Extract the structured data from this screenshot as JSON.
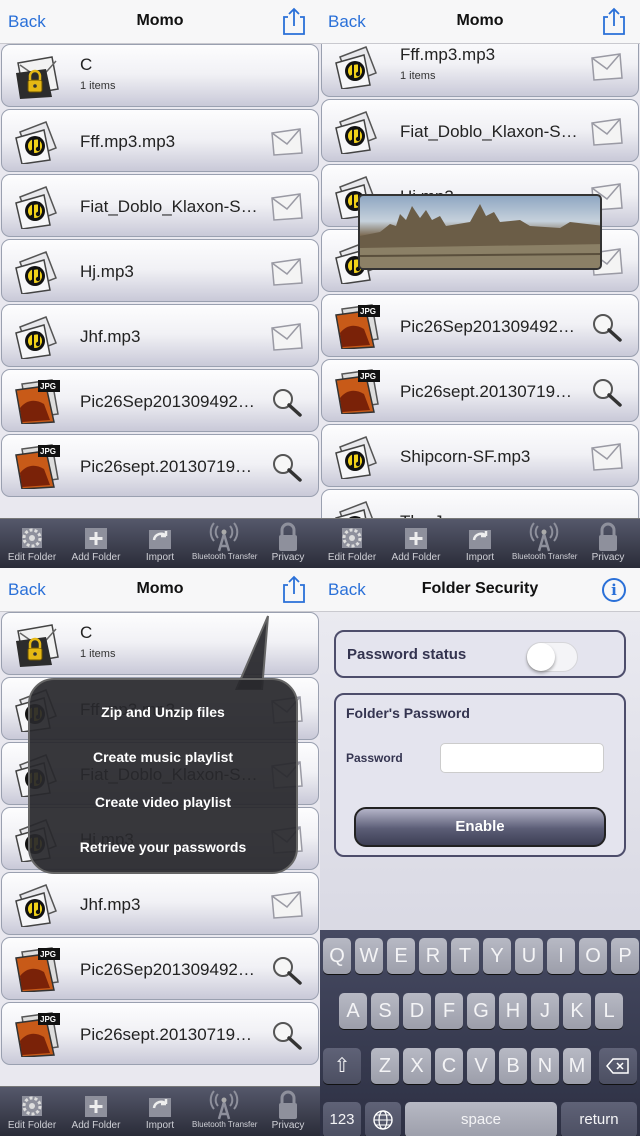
{
  "nav": {
    "back_label": "Back",
    "title": "Momo"
  },
  "security_nav": {
    "back_label": "Back",
    "title": "Folder Security"
  },
  "quadrant1": {
    "rows": [
      {
        "name": "C",
        "sub": "1 items",
        "icon": "folder-lock-icon",
        "action": ""
      },
      {
        "name": "Fff.mp3.mp3",
        "icon": "music-file-icon",
        "action": "mail-icon"
      },
      {
        "name": "Fiat_Doblo_Klaxon-S…",
        "icon": "music-file-icon",
        "action": "mail-icon"
      },
      {
        "name": "Hj.mp3",
        "icon": "music-file-icon",
        "action": "mail-icon"
      },
      {
        "name": "Jhf.mp3",
        "icon": "music-file-icon",
        "action": "mail-icon"
      },
      {
        "name": "Pic26Sep201309492…",
        "icon": "jpg-file-icon",
        "action": "magnifier-icon"
      },
      {
        "name": "Pic26sept.20130719…",
        "icon": "jpg-file-icon",
        "action": "magnifier-icon"
      }
    ]
  },
  "quadrant2": {
    "rows": [
      {
        "name": "Fff.mp3.mp3",
        "sub": "1 items",
        "icon": "music-file-icon",
        "action": "mail-icon"
      },
      {
        "name": "Fiat_Doblo_Klaxon-S…",
        "icon": "music-file-icon",
        "action": "mail-icon"
      },
      {
        "name": "Hj.mp3",
        "icon": "music-file-icon",
        "action": "mail-icon"
      },
      {
        "name": "",
        "icon": "music-file-icon",
        "action": "mail-icon"
      },
      {
        "name": "Pic26Sep201309492…",
        "icon": "jpg-file-icon",
        "action": "magnifier-icon"
      },
      {
        "name": "Pic26sept.20130719…",
        "icon": "jpg-file-icon",
        "action": "magnifier-icon"
      },
      {
        "name": "Shipcorn-SF.mp3",
        "icon": "music-file-icon",
        "action": "mail-icon"
      },
      {
        "name": "The Journey.mp…",
        "icon": "music-file-icon",
        "action": ""
      }
    ]
  },
  "quadrant3": {
    "rows": [
      {
        "name": "C",
        "sub": "1 items",
        "icon": "folder-lock-icon",
        "action": ""
      },
      {
        "name": "Fff.mp3.mp3",
        "icon": "music-file-icon",
        "action": "mail-icon"
      },
      {
        "name": "Fiat_Doblo_Klaxon-S…",
        "icon": "music-file-icon",
        "action": "mail-icon"
      },
      {
        "name": "Hj.mp3",
        "icon": "music-file-icon",
        "action": "mail-icon"
      },
      {
        "name": "Jhf.mp3",
        "icon": "music-file-icon",
        "action": "mail-icon"
      },
      {
        "name": "Pic26Sep201309492…",
        "icon": "jpg-file-icon",
        "action": "magnifier-icon"
      },
      {
        "name": "Pic26sept.20130719…",
        "icon": "jpg-file-icon",
        "action": "magnifier-icon"
      }
    ]
  },
  "popover": {
    "options": [
      "Zip and Unzip files",
      "Create music playlist",
      "Create video playlist",
      "Retrieve your passwords"
    ]
  },
  "tabbar": {
    "items": [
      {
        "label": "Edit Folder",
        "icon": "gear-icon"
      },
      {
        "label": "Add Folder",
        "icon": "add-folder-icon"
      },
      {
        "label": "Import",
        "icon": "import-icon"
      },
      {
        "label": "Bluetooth Transfer",
        "icon": "antenna-icon"
      },
      {
        "label": "Privacy",
        "icon": "lock-icon"
      }
    ]
  },
  "security": {
    "password_status_label": "Password status",
    "password_status_on": false,
    "folder_password_heading": "Folder's Password",
    "password_label": "Password",
    "password_value": "",
    "enable_label": "Enable"
  },
  "keyboard": {
    "row1": [
      "Q",
      "W",
      "E",
      "R",
      "T",
      "Y",
      "U",
      "I",
      "O",
      "P"
    ],
    "row2": [
      "A",
      "S",
      "D",
      "F",
      "G",
      "H",
      "J",
      "K",
      "L"
    ],
    "row3": [
      "Z",
      "X",
      "C",
      "V",
      "B",
      "N",
      "M"
    ],
    "numbers_label": "123",
    "space_label": "space",
    "return_label": "return"
  },
  "colors": {
    "accent": "#2a70d8",
    "tabbar": "#3a3c4c",
    "card_border": "#4d4d6b"
  }
}
